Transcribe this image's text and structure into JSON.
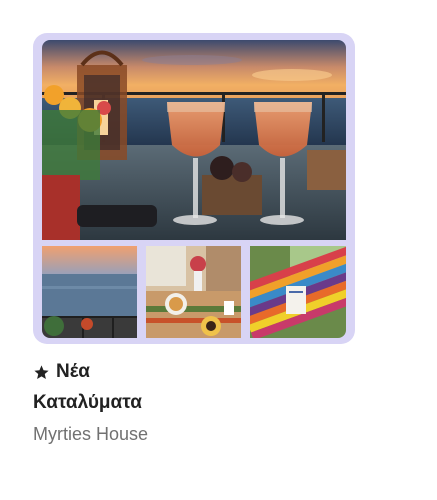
{
  "listing": {
    "badge_icon": "star-icon",
    "title_line1": "Νέα",
    "title_line2": "Καταλύματα",
    "subtitle": "Myrties House"
  },
  "photos": [
    {
      "name": "listing-photo-terrace-wine"
    },
    {
      "name": "listing-photo-sea-sunset"
    },
    {
      "name": "listing-photo-breakfast-table"
    },
    {
      "name": "listing-photo-hammock"
    }
  ],
  "colors": {
    "card_background": "#d8d4f5",
    "title": "#222222",
    "subtitle": "#717171"
  }
}
